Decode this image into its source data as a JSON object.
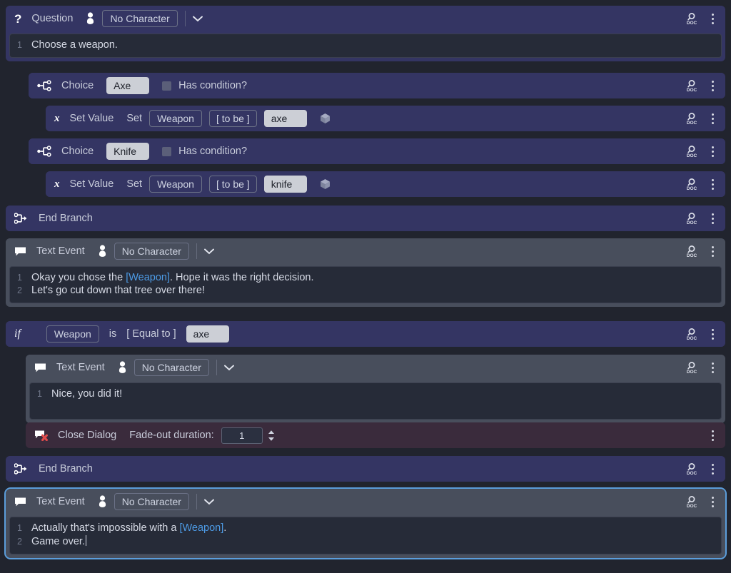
{
  "colors": {
    "page_bg": "#21242e",
    "header_purple": "#343563",
    "header_grey": "#484e5c",
    "header_maroon": "#3a2b3c",
    "text_area_bg": "#262b38",
    "input_light_bg": "#cccfd6",
    "token_blue": "#4d9be6",
    "selection_outline": "#5b9ddb"
  },
  "nodes": {
    "question": {
      "type_label": "Question",
      "icon": "question-mark-icon",
      "character_icon": "person-icon",
      "character": "No Character",
      "expand_icon": "chevron-down-icon",
      "doc_icon": "search-doc-icon",
      "menu_icon": "kebab-menu-icon",
      "lines": [
        {
          "num": "1",
          "text": "Choose a weapon."
        }
      ]
    },
    "choice_axe": {
      "type_label": "Choice",
      "icon": "branch-split-icon",
      "value": "Axe",
      "condition_label": "Has condition?",
      "condition_checked": false
    },
    "set_value_axe": {
      "type_label": "Set Value",
      "icon": "variable-x-icon",
      "verb": "Set",
      "variable": "Weapon",
      "operator": "[ to be ]",
      "value": "axe",
      "cube_icon": "cube-icon"
    },
    "choice_knife": {
      "type_label": "Choice",
      "icon": "branch-split-icon",
      "value": "Knife",
      "condition_label": "Has condition?",
      "condition_checked": false
    },
    "set_value_knife": {
      "type_label": "Set Value",
      "icon": "variable-x-icon",
      "verb": "Set",
      "variable": "Weapon",
      "operator": "[ to be ]",
      "value": "knife",
      "cube_icon": "cube-icon"
    },
    "end_branch_1": {
      "type_label": "End Branch",
      "icon": "end-branch-icon"
    },
    "text_event_1": {
      "type_label": "Text Event",
      "icon": "speech-bubble-icon",
      "character_icon": "person-icon",
      "character": "No Character",
      "expand_icon": "chevron-down-icon",
      "lines": [
        {
          "num": "1",
          "pre": "Okay you chose the ",
          "token": "[Weapon]",
          "post": ". Hope it was the right decision."
        },
        {
          "num": "2",
          "pre": "Let's go cut down that tree over there!",
          "token": "",
          "post": ""
        }
      ]
    },
    "condition_if": {
      "keyword": "if",
      "variable": "Weapon",
      "is_label": "is",
      "operator": "[ Equal to ]",
      "value": "axe"
    },
    "text_event_2": {
      "type_label": "Text Event",
      "icon": "speech-bubble-icon",
      "character_icon": "person-icon",
      "character": "No Character",
      "expand_icon": "chevron-down-icon",
      "lines": [
        {
          "num": "1",
          "pre": "Nice, you did it!",
          "token": "",
          "post": ""
        }
      ]
    },
    "close_dialog": {
      "type_label": "Close Dialog",
      "icon": "close-dialog-icon",
      "field_label": "Fade-out duration:",
      "field_value": "1",
      "stepper_icon": "stepper-updown-icon"
    },
    "end_branch_2": {
      "type_label": "End Branch",
      "icon": "end-branch-icon"
    },
    "text_event_3": {
      "type_label": "Text Event",
      "icon": "speech-bubble-icon",
      "character_icon": "person-icon",
      "character": "No Character",
      "expand_icon": "chevron-down-icon",
      "selected": true,
      "lines": [
        {
          "num": "1",
          "pre": "Actually that's impossible with a ",
          "token": "[Weapon]",
          "post": "."
        },
        {
          "num": "2",
          "pre": "Game over.",
          "token": "",
          "post": "",
          "caret": true
        }
      ]
    }
  }
}
